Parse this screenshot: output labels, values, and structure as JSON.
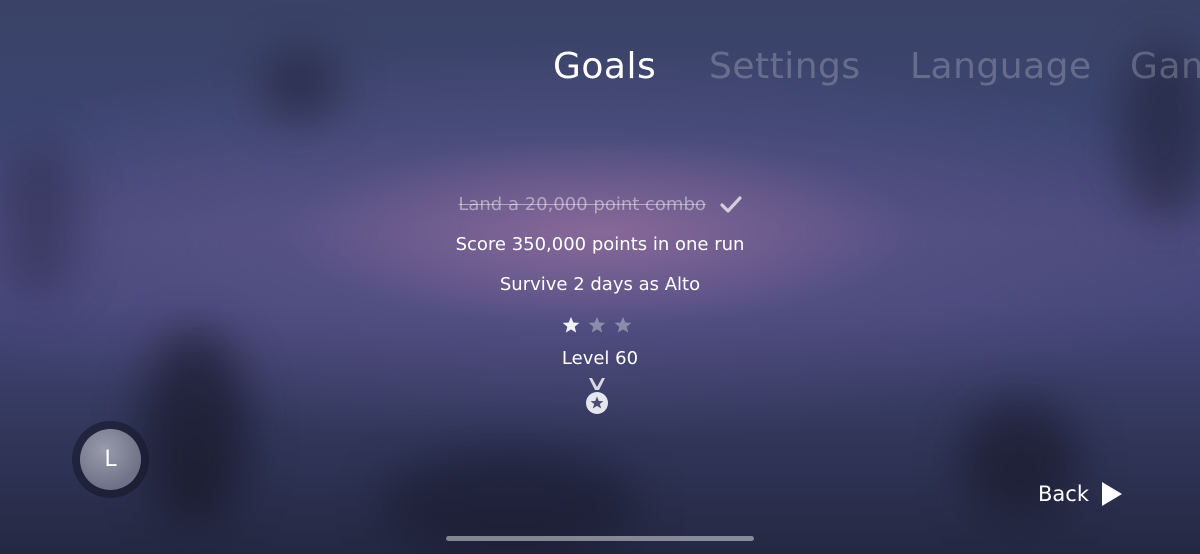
{
  "tabs": [
    {
      "label": "Goals",
      "active": true
    },
    {
      "label": "Settings",
      "active": false
    },
    {
      "label": "Language",
      "active": false
    },
    {
      "label": "Gam",
      "active": false
    }
  ],
  "goals": {
    "items": [
      {
        "text": "Land a 20,000 point combo",
        "completed": true
      },
      {
        "text": "Score 350,000 points in one run",
        "completed": false
      },
      {
        "text": "Survive 2 days as Alto",
        "completed": false
      }
    ],
    "stars": {
      "earned": 1,
      "total": 3
    },
    "level_label": "Level 60"
  },
  "profile": {
    "initial": "L"
  },
  "navigation": {
    "back_label": "Back"
  },
  "colors": {
    "accent": "#ffffff",
    "inactive_tab": "rgba(255,255,255,0.22)",
    "completed_goal": "rgba(255,255,255,0.45)"
  },
  "icons": {
    "check": "check-icon",
    "star": "star-icon",
    "medal": "medal-icon",
    "back": "play-triangle-icon"
  }
}
